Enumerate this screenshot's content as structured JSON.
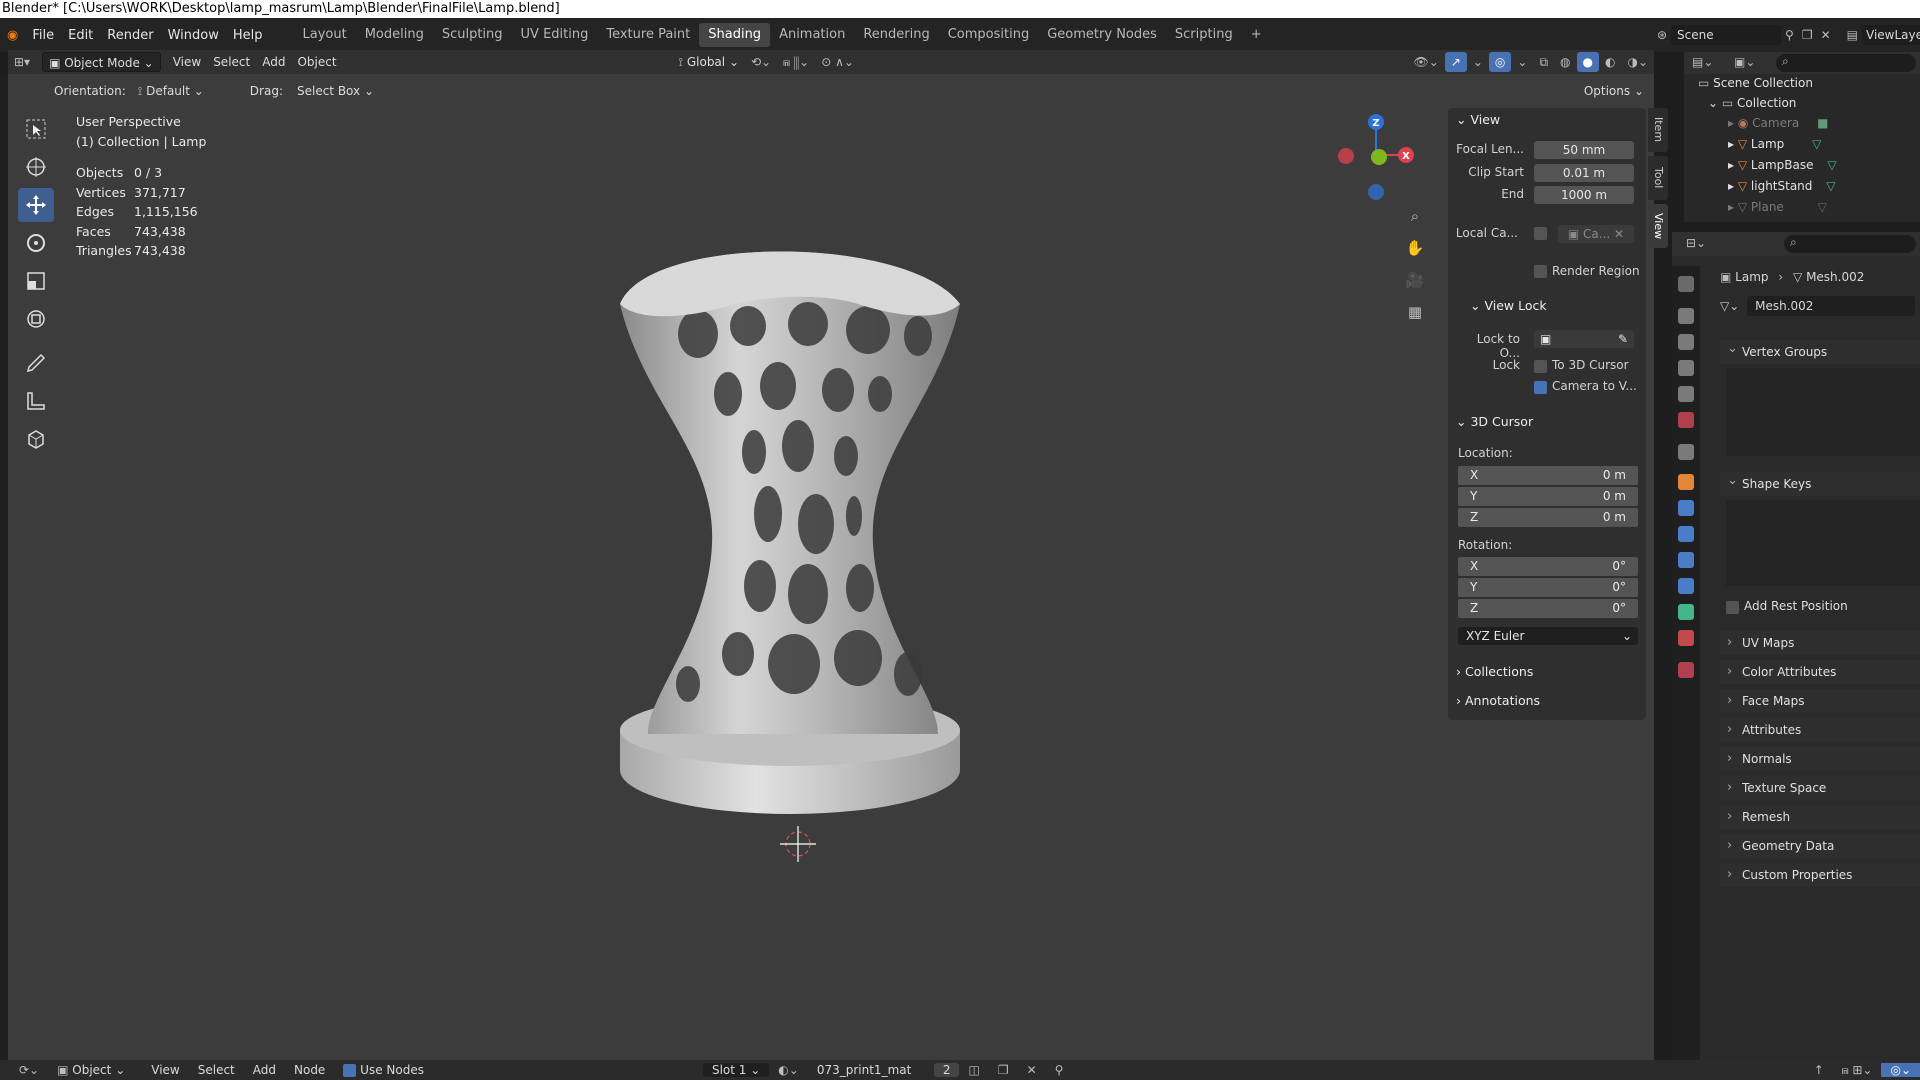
{
  "window": {
    "title": "Blender* [C:\\Users\\WORK\\Desktop\\lamp_masrum\\Lamp\\Blender\\FinalFile\\Lamp.blend]"
  },
  "menu": [
    "File",
    "Edit",
    "Render",
    "Window",
    "Help"
  ],
  "workspaces": [
    "Layout",
    "Modeling",
    "Sculpting",
    "UV Editing",
    "Texture Paint",
    "Shading",
    "Animation",
    "Rendering",
    "Compositing",
    "Geometry Nodes",
    "Scripting"
  ],
  "active_workspace": "Shading",
  "topright": {
    "scene": "Scene",
    "viewlayer": "ViewLayer"
  },
  "viewport_header": {
    "mode": "Object Mode",
    "menus": [
      "View",
      "Select",
      "Add",
      "Object"
    ],
    "transform_orientation": "Global"
  },
  "tool_settings": {
    "orientation_label": "Orientation:",
    "orientation_value": "Default",
    "drag_label": "Drag:",
    "drag_value": "Select Box",
    "options_label": "Options"
  },
  "overlay_text": {
    "perspective": "User Perspective",
    "context": "(1) Collection | Lamp"
  },
  "stats": [
    {
      "label": "Objects",
      "value": "0 / 3"
    },
    {
      "label": "Vertices",
      "value": "371,717"
    },
    {
      "label": "Edges",
      "value": "1,115,156"
    },
    {
      "label": "Faces",
      "value": "743,438"
    },
    {
      "label": "Triangles",
      "value": "743,438"
    }
  ],
  "side_tabs": [
    "Item",
    "Tool",
    "View"
  ],
  "npanel": {
    "view_section": "View",
    "focal_label": "Focal Len...",
    "focal_value": "50 mm",
    "clip_start_label": "Clip Start",
    "clip_start_value": "0.01 m",
    "clip_end_label": "End",
    "clip_end_value": "1000 m",
    "local_camera_label": "Local Ca...",
    "local_camera_value": "Ca...",
    "render_region": "Render Region",
    "view_lock_section": "View Lock",
    "lock_to_label": "Lock to O...",
    "lock_label": "Lock",
    "to_3d_cursor": "To 3D Cursor",
    "camera_to_view": "Camera to V...",
    "cursor_section": "3D Cursor",
    "location_label": "Location:",
    "location": [
      {
        "axis": "X",
        "value": "0 m"
      },
      {
        "axis": "Y",
        "value": "0 m"
      },
      {
        "axis": "Z",
        "value": "0 m"
      }
    ],
    "rotation_label": "Rotation:",
    "rotation": [
      {
        "axis": "X",
        "value": "0°"
      },
      {
        "axis": "Y",
        "value": "0°"
      },
      {
        "axis": "Z",
        "value": "0°"
      }
    ],
    "rotation_mode": "XYZ Euler",
    "collections_section": "Collections",
    "annotations_section": "Annotations"
  },
  "outliner": {
    "root": "Scene Collection",
    "collection": "Collection",
    "items": [
      {
        "name": "Camera",
        "dim": true
      },
      {
        "name": "Lamp",
        "dim": false
      },
      {
        "name": "LampBase",
        "dim": false
      },
      {
        "name": "lightStand",
        "dim": false
      },
      {
        "name": "Plane",
        "dim": true
      }
    ]
  },
  "properties": {
    "object": "Lamp",
    "mesh": "Mesh.002",
    "datablock": "Mesh.002",
    "open_sections": [
      "Vertex Groups",
      "Shape Keys"
    ],
    "add_rest_position": "Add Rest Position",
    "sections": [
      "UV Maps",
      "Color Attributes",
      "Face Maps",
      "Attributes",
      "Normals",
      "Texture Space",
      "Remesh",
      "Geometry Data",
      "Custom Properties"
    ]
  },
  "bottom_bar": {
    "editor": "Object",
    "menus": [
      "View",
      "Select",
      "Add",
      "Node"
    ],
    "use_nodes": "Use Nodes",
    "slot": "Slot 1",
    "material": "073_print1_mat",
    "users": "2"
  },
  "colors": {
    "accent": "#4772b3",
    "viewport": "#3c3c3c",
    "x_axis": "#e0414f",
    "y_axis": "#7fb81d",
    "z_axis": "#2d73d6"
  }
}
